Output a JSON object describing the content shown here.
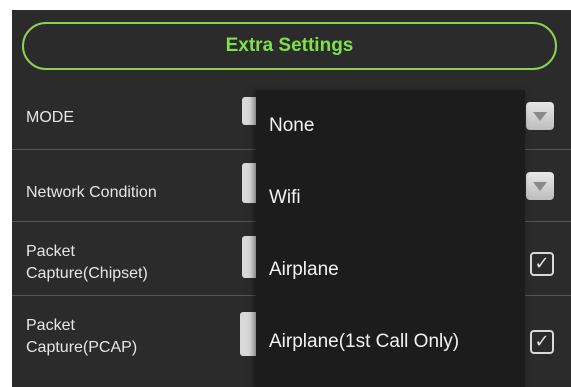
{
  "header": {
    "title": "Extra Settings"
  },
  "rows": [
    {
      "label": "MODE",
      "control": "spinner",
      "icon": "chevron-down-icon"
    },
    {
      "label": "Network Condition",
      "control": "spinner",
      "icon": "chevron-down-icon"
    },
    {
      "label_line1": "Packet",
      "label_line2": "Capture(Chipset)",
      "control": "checkbox",
      "checked": true,
      "check_glyph": "✓"
    },
    {
      "label_line1": "Packet",
      "label_line2": "Capture(PCAP)",
      "control": "checkbox",
      "checked": true,
      "check_glyph": "✓"
    }
  ],
  "dropdown": {
    "options": [
      "None",
      "Wifi",
      "Airplane",
      "Airplane(1st Call Only)"
    ]
  },
  "colors": {
    "panel_bg": "#2b2b2b",
    "accent_green": "#7ee04a",
    "pill_border": "#8fd14f",
    "dropdown_bg": "#1c1c1c"
  }
}
